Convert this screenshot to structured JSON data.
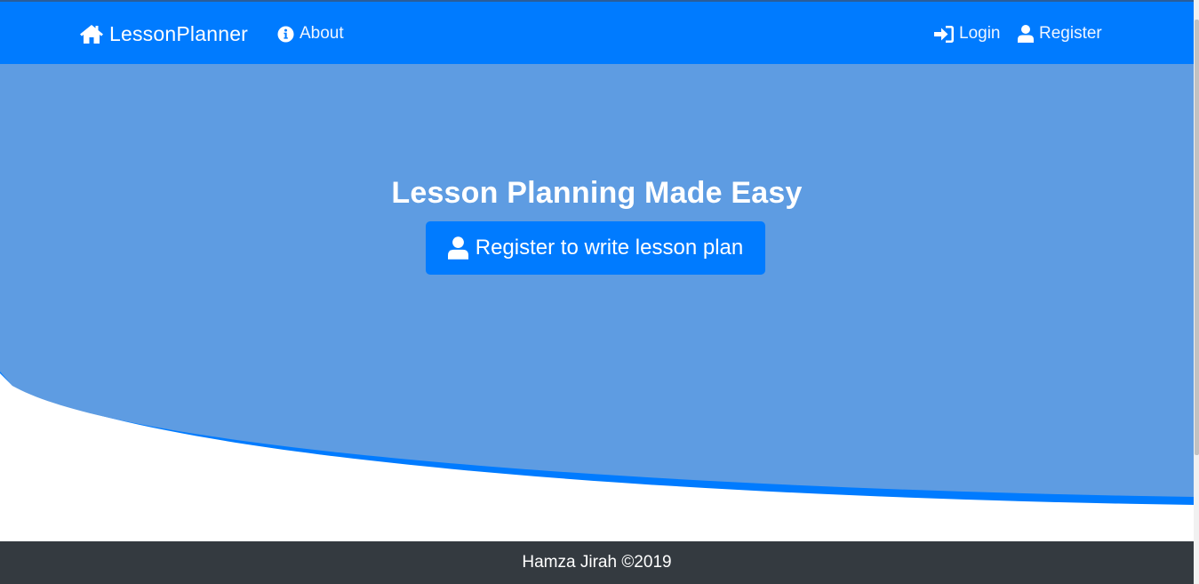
{
  "navbar": {
    "brand": {
      "label": "LessonPlanner",
      "icon": "home-icon"
    },
    "about": {
      "label": "About",
      "icon": "info-circle-icon"
    },
    "login": {
      "label": "Login",
      "icon": "sign-in-icon"
    },
    "register": {
      "label": "Register",
      "icon": "user-icon"
    }
  },
  "hero": {
    "title": "Lesson Planning Made Easy",
    "cta_label": "Register to write lesson plan",
    "cta_icon": "user-icon"
  },
  "footer": {
    "text": "Hamza Jirah ©2019"
  },
  "colors": {
    "navbar": "#007bff",
    "hero": "#5e9ce2",
    "wave_edge": "#007bff",
    "button": "#007bff",
    "footer": "#343a40"
  }
}
